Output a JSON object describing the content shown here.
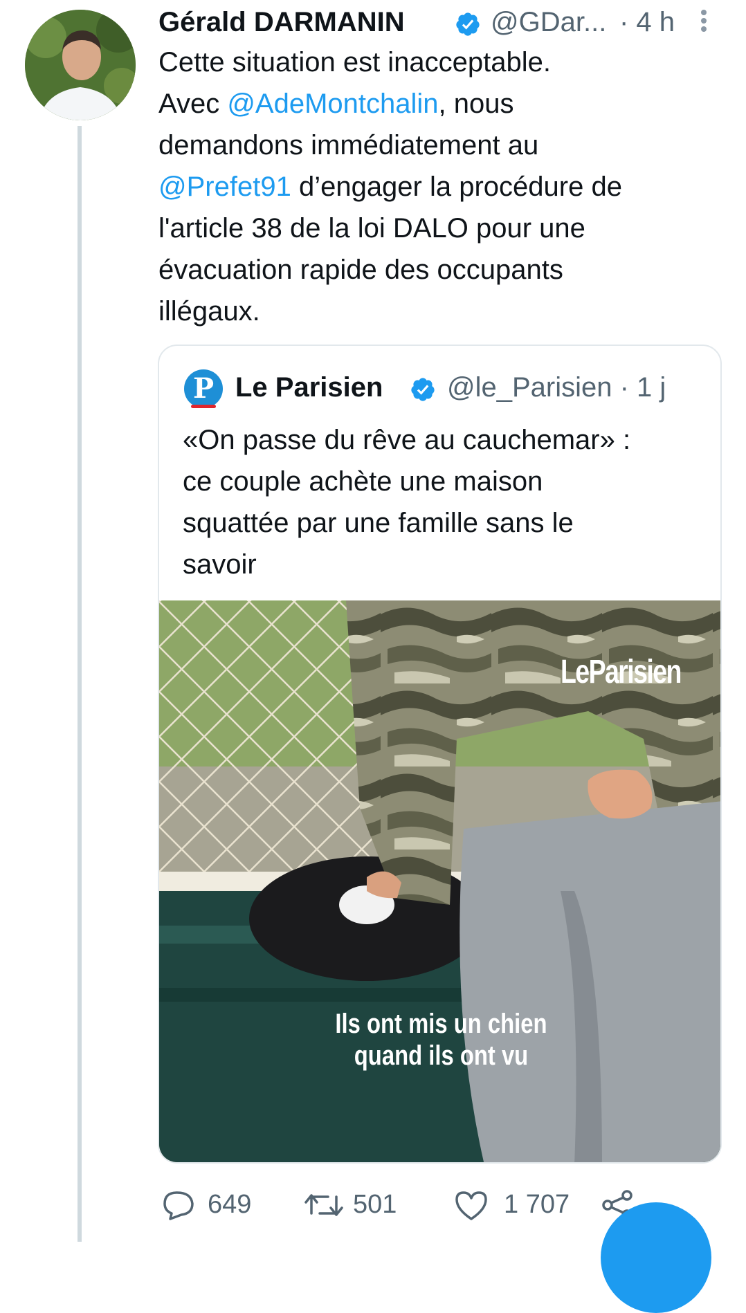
{
  "author": {
    "name": "Gérald DARMANIN",
    "handle": "@GDar...",
    "time": "· 4 h"
  },
  "tweet": {
    "lines": [
      [
        "Cette situation est inacceptable."
      ],
      [
        "Avec ",
        "@AdeMontchalin",
        ", nous"
      ],
      [
        "demandons immédiatement au"
      ],
      [
        "@Prefet91",
        " d’engager la procédure de"
      ],
      [
        "l'article 38 de la loi DALO pour une"
      ],
      [
        "évacuation rapide des occupants"
      ],
      [
        "illégaux."
      ]
    ],
    "line1": "Cette situation est inacceptable.",
    "line2_pre": "Avec ",
    "line2_mention": "@AdeMontchalin",
    "line2_post": ", nous",
    "line3": "demandons immédiatement au",
    "line4_mention": "@Prefet91",
    "line4_post": " d’engager la procédure de",
    "line5": "l'article 38 de la loi DALO pour une",
    "line6": "évacuation rapide des occupants",
    "line7": "illégaux."
  },
  "quote": {
    "logo_letter": "P",
    "name": "Le Parisien",
    "handle": "@le_Parisien · 1 j",
    "line1": "«On passe du rêve au cauchemar» :",
    "line2": "ce couple achète une maison",
    "line3": "squattée par une famille sans le",
    "line4": "savoir",
    "media": {
      "watermark": "LeParisien",
      "caption_line1": "Ils ont mis un chien",
      "caption_line2": "quand ils ont vu"
    }
  },
  "actions": {
    "replies": "649",
    "retweets": "501",
    "likes": "1 707"
  },
  "colors": {
    "accent": "#1d9bf0",
    "secondary_text": "#536471",
    "border": "#e2e8ec"
  },
  "icons": [
    "verified-badge-icon",
    "more-options-icon",
    "reply-icon",
    "retweet-icon",
    "like-icon",
    "share-icon"
  ]
}
